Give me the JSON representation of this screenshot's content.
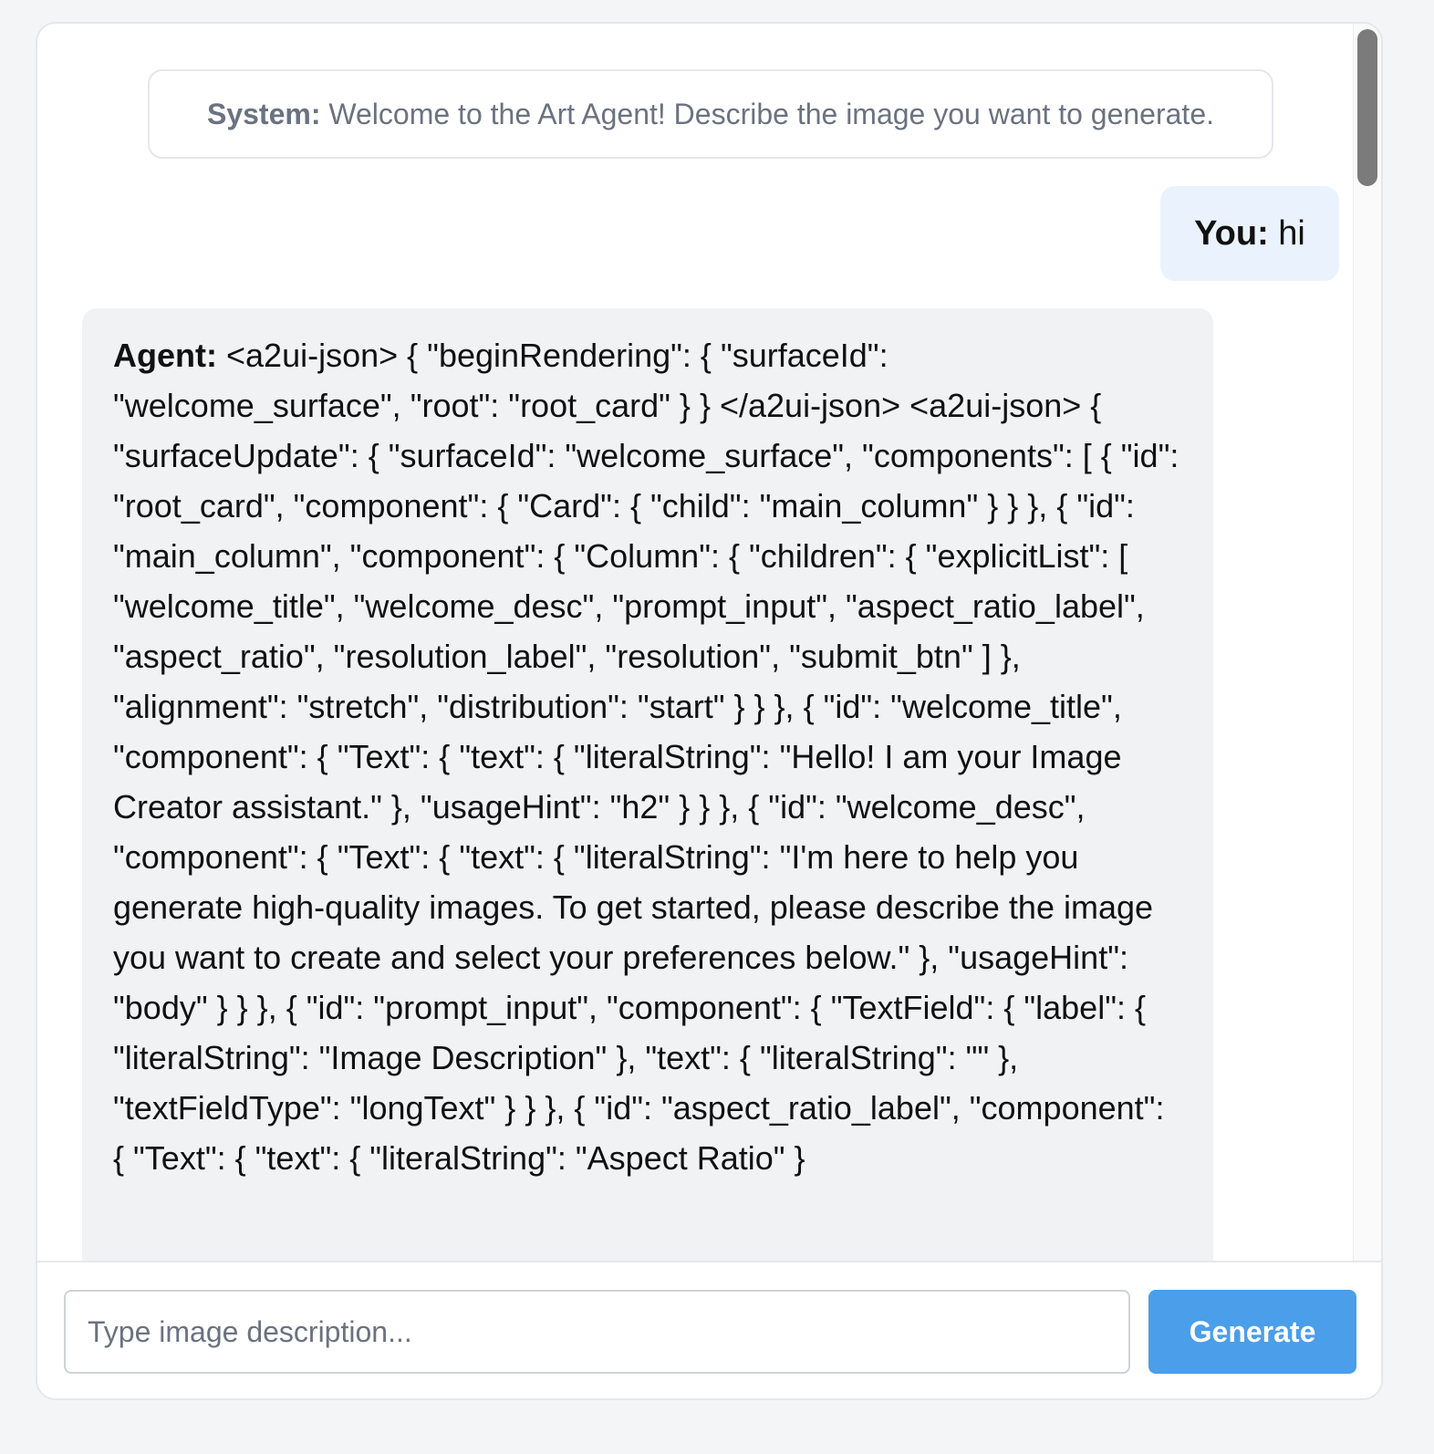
{
  "messages": {
    "system": {
      "label": "System:",
      "text": "Welcome to the Art Agent! Describe the image you want to generate."
    },
    "user": {
      "label": "You:",
      "text": "hi"
    },
    "agent": {
      "label": "Agent:",
      "text": "<a2ui-json> { \"beginRendering\": { \"surfaceId\": \"welcome_surface\", \"root\": \"root_card\" } } </a2ui-json> <a2ui-json> { \"surfaceUpdate\": { \"surfaceId\": \"welcome_surface\", \"components\": [ { \"id\": \"root_card\", \"component\": { \"Card\": { \"child\": \"main_column\" } } }, { \"id\": \"main_column\", \"component\": { \"Column\": { \"children\": { \"explicitList\": [ \"welcome_title\", \"welcome_desc\", \"prompt_input\", \"aspect_ratio_label\", \"aspect_ratio\", \"resolution_label\", \"resolution\", \"submit_btn\" ] }, \"alignment\": \"stretch\", \"distribution\": \"start\" } } }, { \"id\": \"welcome_title\", \"component\": { \"Text\": { \"text\": { \"literalString\": \"Hello! I am your Image Creator assistant.\" }, \"usageHint\": \"h2\" } } }, { \"id\": \"welcome_desc\", \"component\": { \"Text\": { \"text\": { \"literalString\": \"I'm here to help you generate high-quality images. To get started, please describe the image you want to create and select your preferences below.\" }, \"usageHint\": \"body\" } } }, { \"id\": \"prompt_input\", \"component\": { \"TextField\": { \"label\": { \"literalString\": \"Image Description\" }, \"text\": { \"literalString\": \"\" }, \"textFieldType\": \"longText\" } } }, { \"id\": \"aspect_ratio_label\", \"component\": { \"Text\": { \"text\": { \"literalString\": \"Aspect Ratio\" }"
    }
  },
  "composer": {
    "placeholder": "Type image description...",
    "value": "",
    "generate_label": "Generate"
  },
  "colors": {
    "accent": "#4a9eea",
    "user_bubble": "#eaf3fd",
    "agent_bubble": "#f1f2f4",
    "system_text": "#6b7280"
  }
}
